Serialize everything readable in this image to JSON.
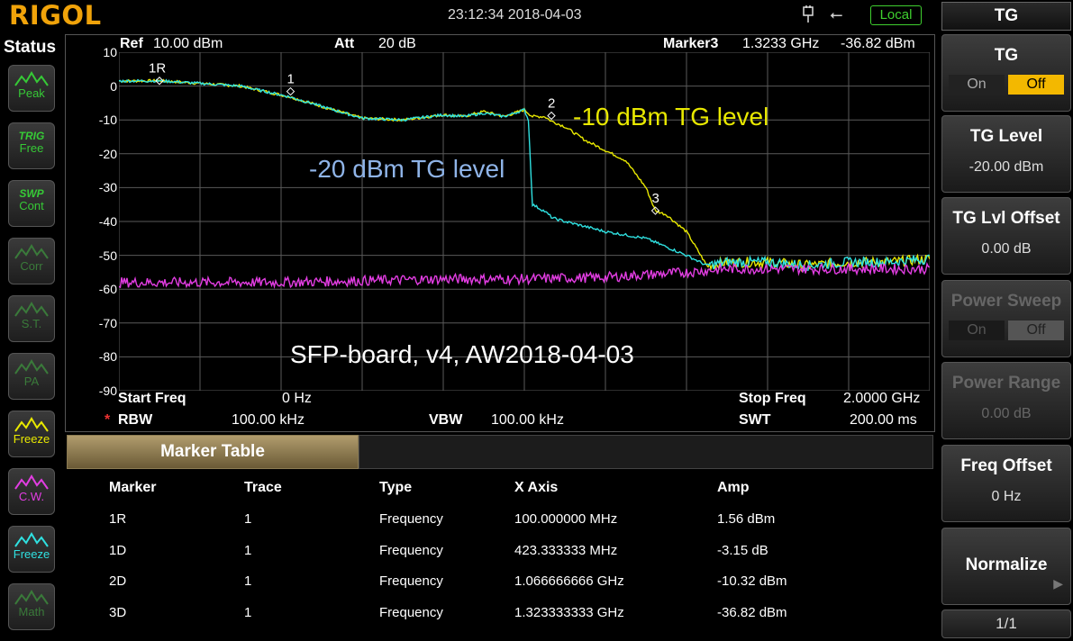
{
  "header": {
    "brand": "RIGOL",
    "datetime": "23:12:34 2018-04-03",
    "remote_status": "Local"
  },
  "status_panel": {
    "title": "Status",
    "buttons": [
      {
        "top": "",
        "label": "Peak",
        "color": "#36c936",
        "enabled": true
      },
      {
        "top": "TRIG",
        "label": "Free",
        "color": "#36c936",
        "enabled": true
      },
      {
        "top": "SWP",
        "label": "Cont",
        "color": "#36c936",
        "enabled": true
      },
      {
        "top": "",
        "label": "Corr",
        "color": "#3a7a3a",
        "enabled": false
      },
      {
        "top": "",
        "label": "S.T.",
        "color": "#3a7a3a",
        "enabled": false
      },
      {
        "top": "",
        "label": "PA",
        "color": "#3a7a3a",
        "enabled": false
      },
      {
        "top": "",
        "label": "Freeze",
        "color": "#e8e800",
        "enabled": true
      },
      {
        "top": "",
        "label": "C.W.",
        "color": "#e23de2",
        "enabled": true
      },
      {
        "top": "",
        "label": "Freeze",
        "color": "#2fe0e0",
        "enabled": true
      },
      {
        "top": "",
        "label": "Math",
        "color": "#3a7a3a",
        "enabled": false
      }
    ]
  },
  "plot_info": {
    "ref_label": "Ref",
    "ref_value": "10.00 dBm",
    "att_label": "Att",
    "att_value": "20 dB",
    "marker_label": "Marker3",
    "marker_freq": "1.3233 GHz",
    "marker_amp": "-36.82 dBm",
    "start_label": "Start Freq",
    "start_value": "0 Hz",
    "stop_label": "Stop Freq",
    "stop_value": "2.0000 GHz",
    "rbw_label": "RBW",
    "rbw_value": "100.00 kHz",
    "vbw_label": "VBW",
    "vbw_value": "100.00 kHz",
    "swt_label": "SWT",
    "swt_value": "200.00 ms",
    "rbw_star": "*"
  },
  "annotations": {
    "tg10": "-10 dBm TG level",
    "tg20": "-20 dBm TG level",
    "board": "SFP-board, v4, AW2018-04-03"
  },
  "chart_data": {
    "type": "line",
    "xlabel": "",
    "ylabel": "",
    "xlim": [
      0,
      2.0
    ],
    "x_unit": "GHz",
    "ylim": [
      -90,
      10
    ],
    "y_ticks": [
      "10",
      "0",
      "-10",
      "-20",
      "-30",
      "-40",
      "-50",
      "-60",
      "-70",
      "-80",
      "-90"
    ],
    "grid": true,
    "series": [
      {
        "color": "#e8e800",
        "x": [
          0,
          0.1,
          0.2,
          0.3,
          0.42,
          0.5,
          0.6,
          0.7,
          0.8,
          0.85,
          0.9,
          0.95,
          1.0,
          1.02,
          1.05,
          1.066,
          1.1,
          1.15,
          1.2,
          1.25,
          1.3,
          1.323,
          1.35,
          1.4,
          1.45,
          1.5,
          1.6,
          1.7,
          1.8,
          1.9,
          2.0
        ],
        "y": [
          1.5,
          1.56,
          0.8,
          0,
          -3.15,
          -6,
          -9.5,
          -10,
          -8.5,
          -9,
          -7.5,
          -9,
          -7,
          -9,
          -9,
          -10.32,
          -12,
          -16,
          -19,
          -22,
          -30,
          -36.82,
          -38,
          -43,
          -53,
          -52,
          -52,
          -53,
          -52,
          -52,
          -51
        ]
      },
      {
        "color": "#2fe0e0",
        "x": [
          0,
          0.1,
          0.2,
          0.3,
          0.42,
          0.5,
          0.6,
          0.7,
          0.8,
          0.85,
          0.9,
          0.95,
          1.0,
          1.01,
          1.02,
          1.05,
          1.07,
          1.1,
          1.2,
          1.3,
          1.4,
          1.45,
          1.5,
          1.6,
          1.7,
          1.8,
          1.9,
          2.0
        ],
        "y": [
          1.5,
          1.56,
          0.8,
          0,
          -3.15,
          -6,
          -9.5,
          -10,
          -8.5,
          -9,
          -8,
          -9,
          -7,
          -10,
          -35,
          -37,
          -39,
          -40,
          -43,
          -45,
          -50,
          -53,
          -52,
          -52,
          -53,
          -52,
          -52,
          -51
        ]
      },
      {
        "color": "#e23de2",
        "x": [
          0,
          0.2,
          0.4,
          0.6,
          0.8,
          1.0,
          1.2,
          1.4,
          1.5,
          1.6,
          1.7,
          1.8,
          1.9,
          2.0
        ],
        "y": [
          -58,
          -58,
          -58,
          -57.5,
          -57,
          -57,
          -56.5,
          -55,
          -54,
          -54,
          -54,
          -54,
          -54,
          -54
        ]
      }
    ],
    "markers": [
      {
        "label": "1R",
        "x": 0.1,
        "y": 1.56
      },
      {
        "label": "1",
        "x": 0.4233,
        "y": -1.59
      },
      {
        "label": "2",
        "x": 1.0667,
        "y": -8.76
      },
      {
        "label": "3",
        "x": 1.3233,
        "y": -36.82
      }
    ]
  },
  "marker_table": {
    "title": "Marker Table",
    "columns": [
      "Marker",
      "Trace",
      "Type",
      "X Axis",
      "Amp"
    ],
    "rows": [
      [
        "1R",
        "1",
        "Frequency",
        "100.000000 MHz",
        "1.56 dBm"
      ],
      [
        "1D",
        "1",
        "Frequency",
        "423.333333 MHz",
        "-3.15 dB"
      ],
      [
        "2D",
        "1",
        "Frequency",
        "1.066666666 GHz",
        "-10.32 dBm"
      ],
      [
        "3D",
        "1",
        "Frequency",
        "1.323333333 GHz",
        "-36.82 dBm"
      ]
    ]
  },
  "menu": {
    "title": "TG",
    "tg": {
      "label": "TG",
      "on": "On",
      "off": "Off"
    },
    "tg_level": {
      "label": "TG Level",
      "value": "-20.00 dBm"
    },
    "tg_offset": {
      "label": "TG Lvl Offset",
      "value": "0.00 dB"
    },
    "power_sweep": {
      "label": "Power Sweep",
      "on": "On",
      "off": "Off"
    },
    "power_range": {
      "label": "Power Range",
      "value": "0.00 dB"
    },
    "freq_offset": {
      "label": "Freq Offset",
      "value": "0 Hz"
    },
    "normalize": {
      "label": "Normalize"
    },
    "page": "1/1"
  }
}
